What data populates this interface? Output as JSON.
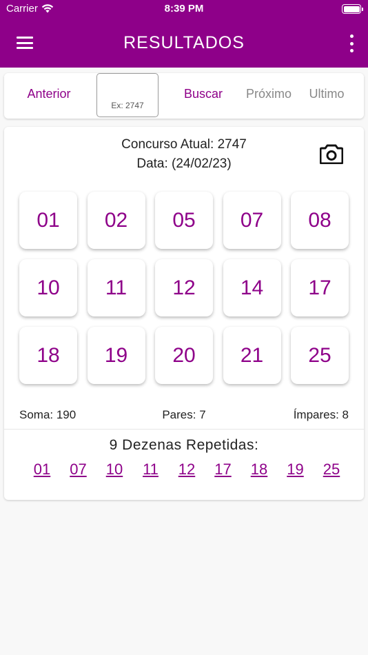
{
  "status_bar": {
    "carrier": "Carrier",
    "time": "8:39 PM"
  },
  "header": {
    "title": "RESULTADOS"
  },
  "search": {
    "prev_label": "Anterior",
    "input_placeholder": "Ex: 2747",
    "search_label": "Buscar",
    "next_label": "Próximo",
    "last_label": "Ultimo"
  },
  "result": {
    "concurso_line": "Concurso Atual: 2747",
    "date_line": "Data: (24/02/23)",
    "numbers": [
      "01",
      "02",
      "05",
      "07",
      "08",
      "10",
      "11",
      "12",
      "14",
      "17",
      "18",
      "19",
      "20",
      "21",
      "25"
    ],
    "soma": "Soma: 190",
    "pares": "Pares: 7",
    "impares": "Ímpares: 8",
    "repetidas_title": "9 Dezenas Repetidas:",
    "repetidas": [
      "01",
      "07",
      "10",
      "11",
      "12",
      "17",
      "18",
      "19",
      "25"
    ]
  },
  "icons": {
    "menu": "menu-icon",
    "more": "more-vertical-icon",
    "camera": "camera-icon",
    "wifi": "wifi-icon",
    "battery": "battery-icon"
  },
  "colors": {
    "brand": "#8e0089",
    "inactive": "#888888",
    "background": "#f8f8f8"
  }
}
